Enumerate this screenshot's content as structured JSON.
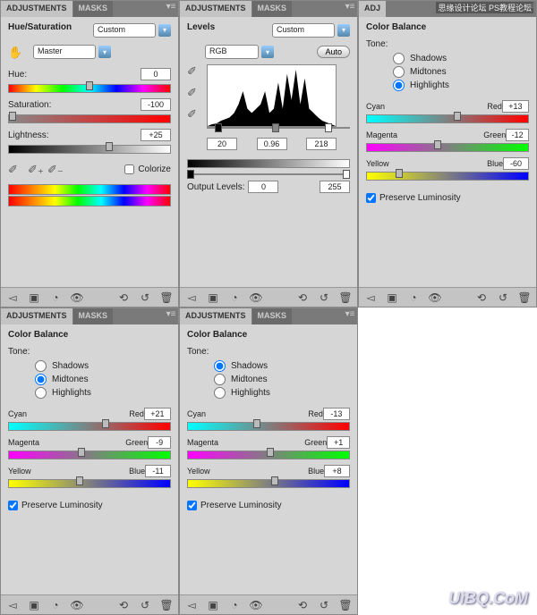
{
  "tabs": {
    "adjustments": "ADJUSTMENTS",
    "masks": "MASKS"
  },
  "common": {
    "auto": "Auto",
    "output_levels": "Output Levels:"
  },
  "hue_sat": {
    "title": "Hue/Saturation",
    "preset": "Custom",
    "channel": "Master",
    "hue_label": "Hue:",
    "hue_val": "0",
    "sat_label": "Saturation:",
    "sat_val": "-100",
    "light_label": "Lightness:",
    "light_val": "+25",
    "colorize": "Colorize"
  },
  "levels": {
    "title": "Levels",
    "preset": "Custom",
    "channel": "RGB",
    "in_black": "20",
    "in_gamma": "0.96",
    "in_white": "218",
    "out_black": "0",
    "out_white": "255"
  },
  "cb1": {
    "title": "Color Balance",
    "tone_label": "Tone:",
    "shadows": "Shadows",
    "midtones": "Midtones",
    "highlights": "Highlights",
    "selected": "highlights",
    "cyan": "Cyan",
    "red": "Red",
    "cr_val": "+13",
    "magenta": "Magenta",
    "green": "Green",
    "mg_val": "-12",
    "yellow": "Yellow",
    "blue": "Blue",
    "yb_val": "-60",
    "preserve": "Preserve Luminosity"
  },
  "cb2": {
    "title": "Color Balance",
    "tone_label": "Tone:",
    "shadows": "Shadows",
    "midtones": "Midtones",
    "highlights": "Highlights",
    "selected": "midtones",
    "cyan": "Cyan",
    "red": "Red",
    "cr_val": "+21",
    "magenta": "Magenta",
    "green": "Green",
    "mg_val": "-9",
    "yellow": "Yellow",
    "blue": "Blue",
    "yb_val": "-11",
    "preserve": "Preserve Luminosity"
  },
  "cb3": {
    "title": "Color Balance",
    "tone_label": "Tone:",
    "shadows": "Shadows",
    "midtones": "Midtones",
    "highlights": "Highlights",
    "selected": "shadows",
    "cyan": "Cyan",
    "red": "Red",
    "cr_val": "-13",
    "magenta": "Magenta",
    "green": "Green",
    "mg_val": "+1",
    "yellow": "Yellow",
    "blue": "Blue",
    "yb_val": "+8",
    "preserve": "Preserve Luminosity"
  },
  "watermark": "UiBQ.CoM",
  "wm2": "思缘设计论坛 PS教程论坛"
}
